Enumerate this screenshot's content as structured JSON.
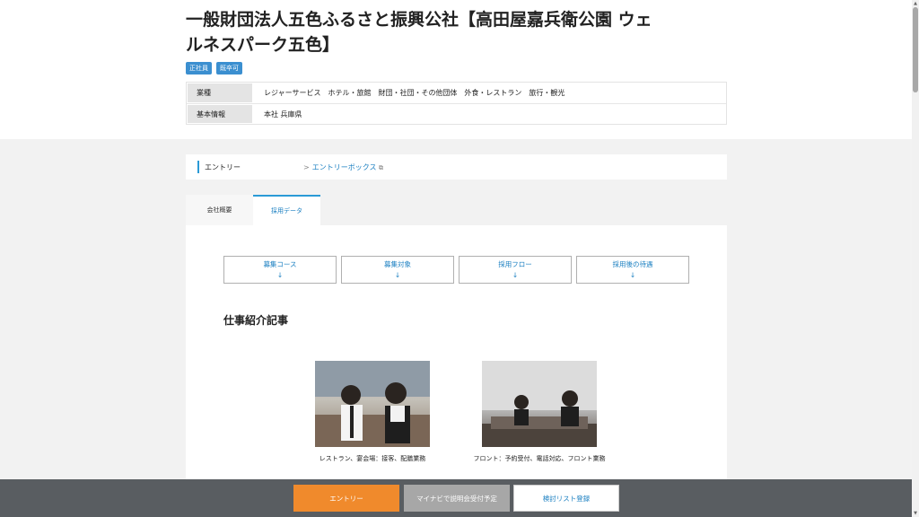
{
  "company": {
    "title": "一般財団法人五色ふるさと振興公社【高田屋嘉兵衛公園 ウェルネスパーク五色】",
    "tags": [
      "正社員",
      "既卒可"
    ]
  },
  "info": [
    {
      "label": "業種",
      "value": "レジャーサービス　ホテル・旅館　財団・社団・その他団体　外食・レストラン　旅行・観光"
    },
    {
      "label": "基本情報",
      "value": "本社  兵庫県"
    }
  ],
  "entry": {
    "label": "エントリー",
    "link": "エントリーボックス",
    "ext": "⧉"
  },
  "tabs": [
    {
      "label": "会社概要"
    },
    {
      "label": "採用データ"
    }
  ],
  "nav_buttons": [
    {
      "label": "募集コース",
      "arrow": "↓"
    },
    {
      "label": "募集対象",
      "arrow": "↓"
    },
    {
      "label": "採用フロー",
      "arrow": "↓"
    },
    {
      "label": "採用後の待遇",
      "arrow": "↓"
    }
  ],
  "section_title": "仕事紹介記事",
  "articles": [
    {
      "caption": "レストラン、宴会場：接客、配膳業務"
    },
    {
      "caption": "フロント：予約受付、電話対応、フロント業務"
    }
  ],
  "bottom_buttons": {
    "entry": "エントリー",
    "briefing": "マイナビで説明会受付予定",
    "list": "検討リスト登録"
  },
  "colors": {
    "accent": "#2a9ad6",
    "entry_button": "#f08a2c",
    "tag": "#3b8fd0"
  }
}
